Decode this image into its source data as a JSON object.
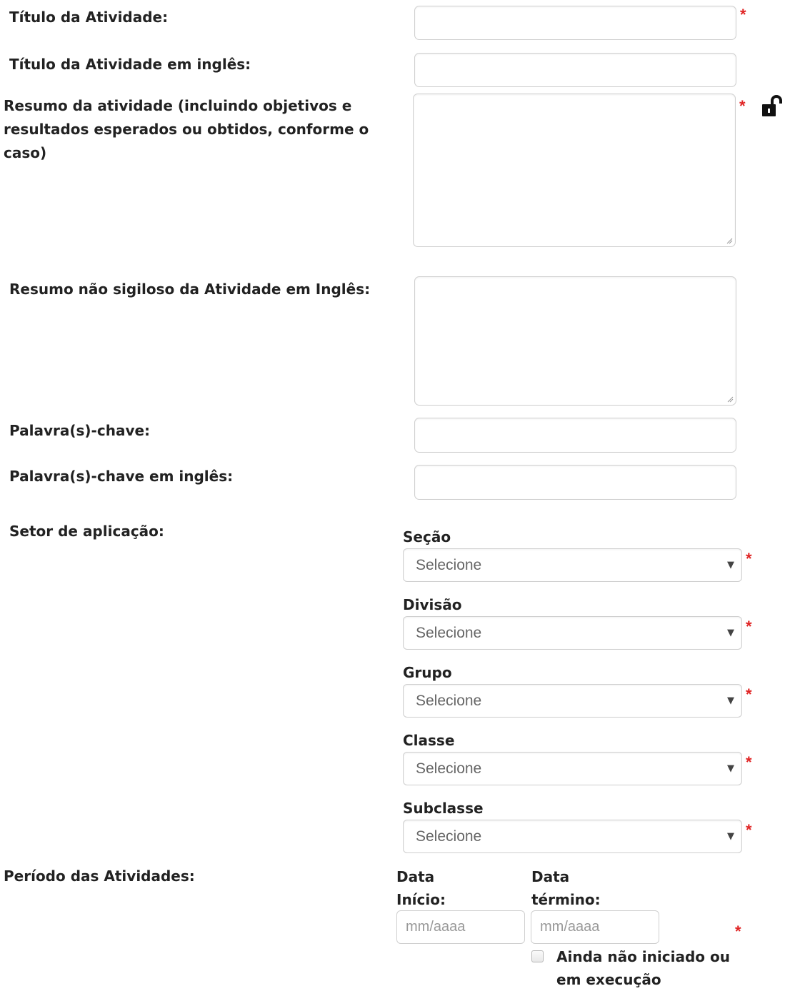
{
  "form": {
    "titulo": {
      "label": "Título da Atividade:",
      "required": "*"
    },
    "titulo_en": {
      "label": "Título da Atividade em inglês:"
    },
    "resumo": {
      "label": "Resumo da atividade (incluindo objetivos e resultados esperados ou obtidos, conforme o caso)",
      "required": "*",
      "lock_icon": "unlocked-padlock-icon"
    },
    "resumo_en": {
      "label": "Resumo não sigiloso da Atividade em Inglês:"
    },
    "palavras": {
      "label": "Palavra(s)-chave:"
    },
    "palavras_en": {
      "label": "Palavra(s)-chave em inglês:"
    },
    "setor": {
      "label": "Setor de aplicação:",
      "selects": [
        {
          "label": "Seção",
          "value": "Selecione",
          "required": "*"
        },
        {
          "label": "Divisão",
          "value": "Selecione",
          "required": "*"
        },
        {
          "label": "Grupo",
          "value": "Selecione",
          "required": "*"
        },
        {
          "label": "Classe",
          "value": "Selecione",
          "required": "*"
        },
        {
          "label": "Subclasse",
          "value": "Selecione",
          "required": "*"
        }
      ],
      "arrow_icon": "dropdown-arrow-icon"
    },
    "periodo": {
      "label": "Período das Atividades:",
      "inicio_label": "Data Início:",
      "inicio_placeholder": "mm/aaaa",
      "termino_label": "Data término:",
      "termino_placeholder": "mm/aaaa",
      "required": "*",
      "checkbox_label": "Ainda não iniciado ou em execução",
      "checkbox_checked": false
    }
  },
  "colors": {
    "required": "#e02424",
    "border": "#cfcfcf",
    "text": "#222222"
  }
}
